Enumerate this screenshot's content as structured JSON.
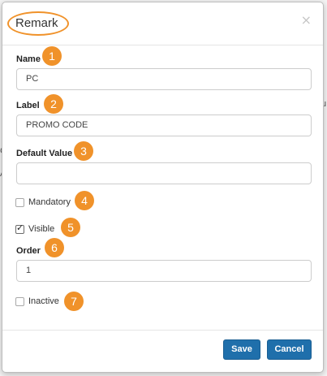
{
  "modal": {
    "title": "Remark",
    "close_glyph": "×"
  },
  "fields": {
    "name": {
      "label": "Name",
      "value": "PC"
    },
    "label": {
      "label": "Label",
      "value": "PROMO CODE"
    },
    "default_value": {
      "label": "Default Value",
      "value": ""
    },
    "order": {
      "label": "Order",
      "value": "1"
    }
  },
  "checkboxes": {
    "mandatory": {
      "label": "Mandatory",
      "checked": false
    },
    "visible": {
      "label": "Visible",
      "checked": true
    },
    "inactive": {
      "label": "Inactive",
      "checked": false
    }
  },
  "badges": [
    "1",
    "2",
    "3",
    "4",
    "5",
    "6",
    "7"
  ],
  "buttons": {
    "save": "Save",
    "cancel": "Cancel"
  },
  "background": {
    "peek_top": "C",
    "peek_mid": "A",
    "peek_right": "u"
  },
  "colors": {
    "annotation": "#f0922a",
    "primary_button": "#1f6fab"
  }
}
